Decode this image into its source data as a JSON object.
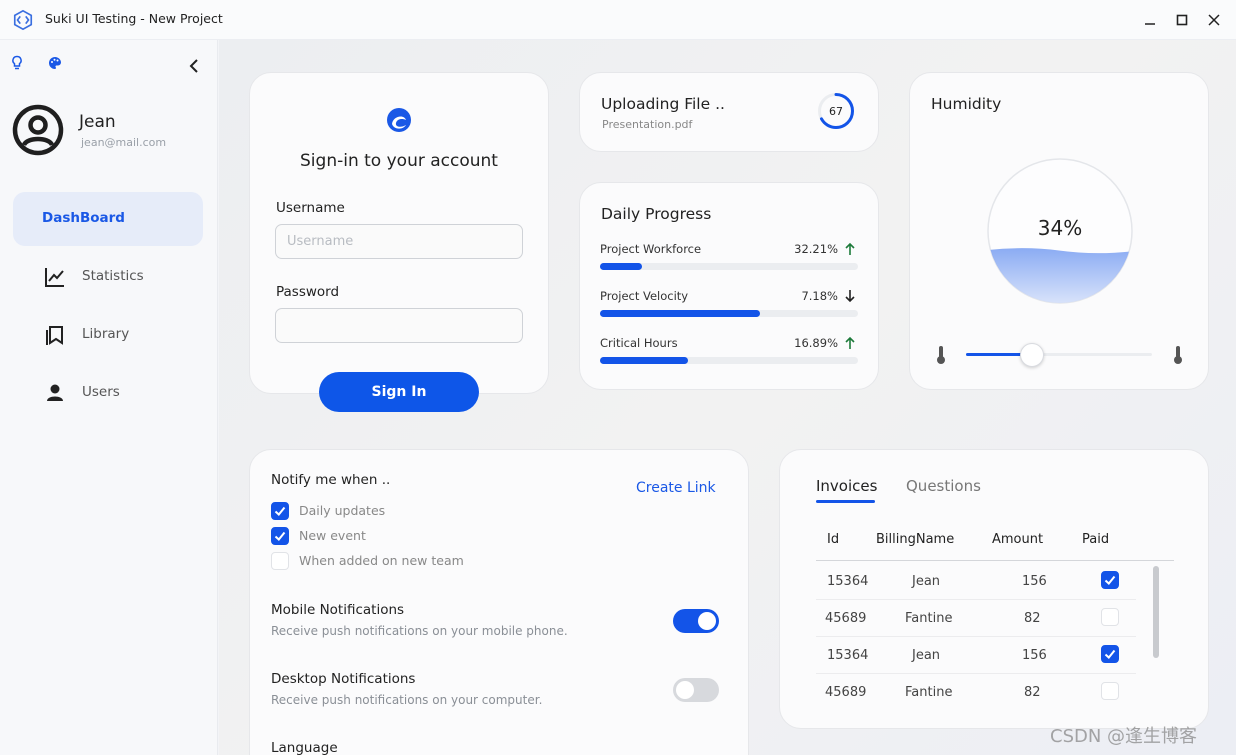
{
  "window": {
    "title": "Suki UI Testing - New Project",
    "controls": {
      "minimize": "minimize-icon",
      "maximize": "maximize-icon",
      "close": "close-icon"
    }
  },
  "sidebar": {
    "top_icons": [
      "lightbulb-icon",
      "palette-icon",
      "chevron-left-icon"
    ],
    "user": {
      "name": "Jean",
      "email": "jean@mail.com",
      "avatar_icon": "user-circle-icon"
    },
    "items": [
      {
        "label": "DashBoard",
        "active": true
      },
      {
        "label": "Statistics",
        "icon": "line-chart-icon"
      },
      {
        "label": "Library",
        "icon": "book-icon"
      },
      {
        "label": "Users",
        "icon": "user-icon"
      }
    ]
  },
  "signin": {
    "title": "Sign-in to your account",
    "username_label": "Username",
    "username_placeholder": "Username",
    "username_value": "",
    "password_label": "Password",
    "password_value": "",
    "button_label": "Sign In"
  },
  "upload": {
    "title": "Uploading File ..",
    "filename": "Presentation.pdf",
    "progress": 67,
    "progress_label": "67"
  },
  "daily_progress": {
    "title": "Daily Progress",
    "rows": [
      {
        "label": "Project Workforce",
        "value": "32.21%",
        "fraction": 0.1628,
        "trend": "up"
      },
      {
        "label": "Project Velocity",
        "value": "7.18%",
        "fraction": 0.62,
        "trend": "down"
      },
      {
        "label": "Critical Hours",
        "value": "16.89%",
        "fraction": 0.341,
        "trend": "up"
      }
    ]
  },
  "humidity": {
    "title": "Humidity",
    "value_label": "34%",
    "level": 0.34,
    "slider_value": 0.355,
    "colors": {
      "accent": "#1354e8",
      "water": "#86a8f2"
    }
  },
  "notifications": {
    "title": "Notify me when ..",
    "create_link": "Create Link",
    "checks": [
      {
        "label": "Daily updates",
        "checked": true
      },
      {
        "label": "New event",
        "checked": true
      },
      {
        "label": "When added on new team",
        "checked": false
      }
    ],
    "mobile": {
      "title": "Mobile Notifications",
      "desc": "Receive push notifications on your mobile phone.",
      "on": true
    },
    "desktop": {
      "title": "Desktop Notifications",
      "desc": "Receive push notifications on your computer.",
      "on": false
    },
    "language_label": "Language"
  },
  "invoices": {
    "tabs": [
      "Invoices",
      "Questions"
    ],
    "active_tab": "Invoices",
    "columns": [
      "Id",
      "BillingName",
      "Amount",
      "Paid"
    ],
    "rows": [
      {
        "id": "15364",
        "name": "Jean",
        "amount": "156",
        "paid": true
      },
      {
        "id": "45689",
        "name": "Fantine",
        "amount": "82",
        "paid": false
      },
      {
        "id": "15364",
        "name": "Jean",
        "amount": "156",
        "paid": true
      },
      {
        "id": "45689",
        "name": "Fantine",
        "amount": "82",
        "paid": false
      }
    ]
  },
  "watermark": "CSDN @逢生博客"
}
